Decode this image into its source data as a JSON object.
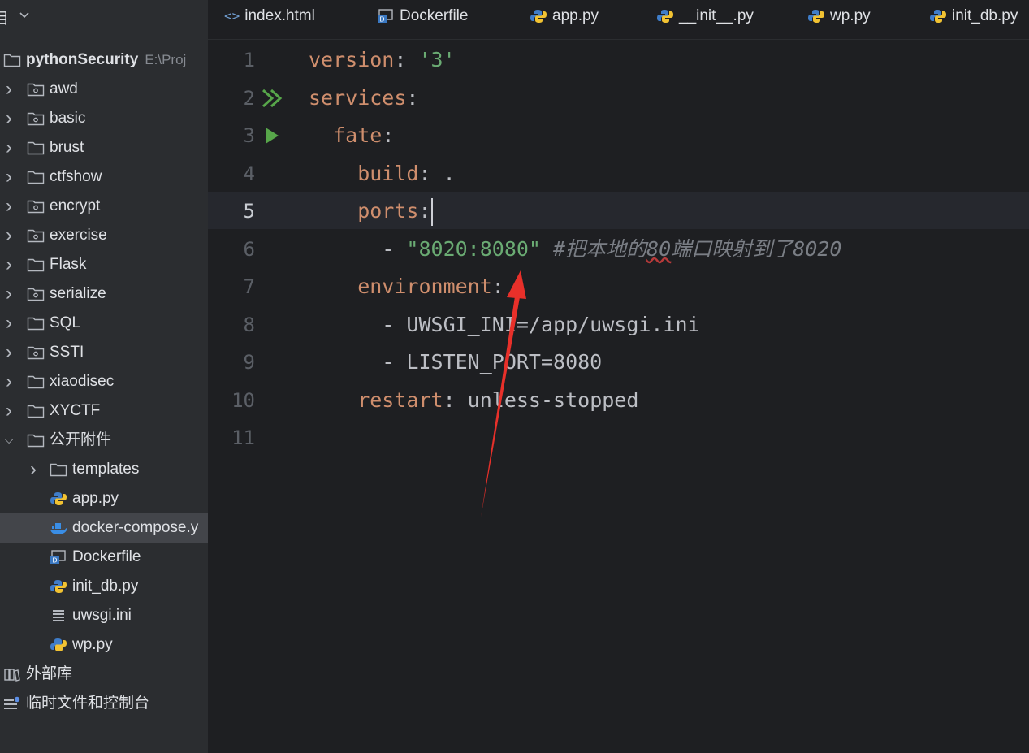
{
  "sidebar": {
    "header_label": "目",
    "items": [
      {
        "label": "pythonSecurity",
        "path": "E:\\Proj",
        "expanded": true,
        "level": 0,
        "icon": "folder-icon",
        "bold": true
      },
      {
        "label": "awd",
        "level": 1,
        "icon": "package-folder-icon"
      },
      {
        "label": "basic",
        "level": 1,
        "icon": "package-folder-icon"
      },
      {
        "label": "brust",
        "level": 1,
        "icon": "folder-icon"
      },
      {
        "label": "ctfshow",
        "level": 1,
        "icon": "folder-icon"
      },
      {
        "label": "encrypt",
        "level": 1,
        "icon": "package-folder-icon"
      },
      {
        "label": "exercise",
        "level": 1,
        "icon": "package-folder-icon"
      },
      {
        "label": "Flask",
        "level": 1,
        "icon": "folder-icon"
      },
      {
        "label": "serialize",
        "level": 1,
        "icon": "package-folder-icon"
      },
      {
        "label": "SQL",
        "level": 1,
        "icon": "folder-icon"
      },
      {
        "label": "SSTI",
        "level": 1,
        "icon": "package-folder-icon"
      },
      {
        "label": "xiaodisec",
        "level": 1,
        "icon": "folder-icon"
      },
      {
        "label": "XYCTF",
        "level": 1,
        "icon": "folder-icon"
      },
      {
        "label": "公开附件",
        "level": 1,
        "icon": "folder-icon",
        "expanded": true
      },
      {
        "label": "templates",
        "level": 2,
        "icon": "folder-icon"
      },
      {
        "label": "app.py",
        "level": 2,
        "icon": "python-file-icon"
      },
      {
        "label": "docker-compose.y",
        "level": 2,
        "icon": "docker-icon",
        "selected": true
      },
      {
        "label": "Dockerfile",
        "level": 2,
        "icon": "dockerfile-icon"
      },
      {
        "label": "init_db.py",
        "level": 2,
        "icon": "python-file-icon"
      },
      {
        "label": "uwsgi.ini",
        "level": 2,
        "icon": "ini-file-icon"
      },
      {
        "label": "wp.py",
        "level": 2,
        "icon": "python-file-icon"
      },
      {
        "label": "外部库",
        "level": 0,
        "icon": "library-icon"
      },
      {
        "label": "临时文件和控制台",
        "level": 0,
        "icon": "scratches-icon"
      }
    ]
  },
  "tabs": [
    {
      "label": "index.html",
      "icon": "html-icon",
      "icon_text": "<>"
    },
    {
      "label": "Dockerfile",
      "icon": "dockerfile-icon"
    },
    {
      "label": "app.py",
      "icon": "python-file-icon"
    },
    {
      "label": "__init__.py",
      "icon": "python-file-icon"
    },
    {
      "label": "wp.py",
      "icon": "python-file-icon"
    },
    {
      "label": "init_db.py",
      "icon": "python-file-icon"
    }
  ],
  "editor": {
    "current_line": 5,
    "lines": [
      {
        "n": "1",
        "parts": [
          {
            "t": "version",
            "c": "k"
          },
          {
            "t": ": ",
            "c": "p"
          },
          {
            "t": "'3'",
            "c": "s"
          }
        ]
      },
      {
        "n": "2",
        "run": "run-all-icon",
        "parts": [
          {
            "t": "services",
            "c": "k"
          },
          {
            "t": ":",
            "c": "p"
          }
        ]
      },
      {
        "n": "3",
        "run": "run-icon",
        "parts": [
          {
            "t": "  fate",
            "c": "k"
          },
          {
            "t": ":",
            "c": "p"
          }
        ]
      },
      {
        "n": "4",
        "parts": [
          {
            "t": "    build",
            "c": "k"
          },
          {
            "t": ": .",
            "c": "p"
          }
        ]
      },
      {
        "n": "5",
        "parts": [
          {
            "t": "    ports",
            "c": "k"
          },
          {
            "t": ":",
            "c": "p"
          }
        ],
        "caret": true
      },
      {
        "n": "6",
        "parts": [
          {
            "t": "      - ",
            "c": "p"
          },
          {
            "t": "\"8020:8080\"",
            "c": "s"
          },
          {
            "t": " #把本地的",
            "c": "c"
          },
          {
            "t": "80",
            "c": "c typo"
          },
          {
            "t": "端口映射到了8020",
            "c": "c"
          }
        ]
      },
      {
        "n": "7",
        "parts": [
          {
            "t": "    environment",
            "c": "k"
          },
          {
            "t": ":",
            "c": "p"
          }
        ]
      },
      {
        "n": "8",
        "parts": [
          {
            "t": "      - UWSGI_INI=/app/uwsgi.ini",
            "c": "p"
          }
        ]
      },
      {
        "n": "9",
        "parts": [
          {
            "t": "      - LISTEN_PORT=8080",
            "c": "p"
          }
        ]
      },
      {
        "n": "10",
        "parts": [
          {
            "t": "    restart",
            "c": "k"
          },
          {
            "t": ": unless-stopped",
            "c": "p"
          }
        ]
      },
      {
        "n": "11",
        "parts": []
      }
    ]
  },
  "colors": {
    "annotation_arrow": "#e8302a"
  }
}
